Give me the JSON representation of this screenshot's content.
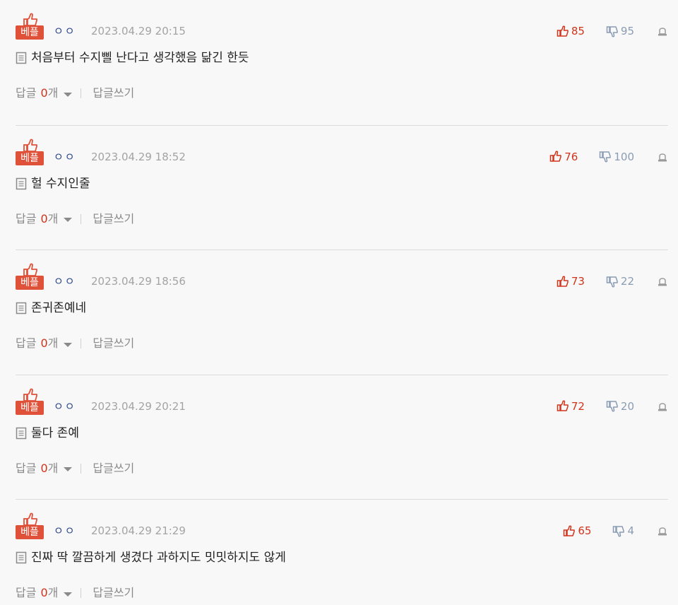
{
  "labels": {
    "best": "베플",
    "reply": "답글",
    "reply_unit": "개",
    "write_reply": "답글쓰기"
  },
  "colors": {
    "accent": "#e0513a",
    "upvote": "#d1341b",
    "downvote": "#8a9cb3",
    "nickname": "#2f4a8c",
    "muted": "#a3a3a3"
  },
  "icons": {
    "best": "thumbs-up-icon",
    "upvote": "thumbs-up-icon",
    "downvote": "thumbs-down-icon",
    "report": "siren-icon",
    "comment": "document-icon"
  },
  "comments": [
    {
      "nickname": "ㅇㅇ",
      "timestamp": "2023.04.29 20:15",
      "up": "85",
      "down": "95",
      "text": "처음부터 수지삘 난다고 생각했음 닮긴 한듯",
      "replies": "0"
    },
    {
      "nickname": "ㅇㅇ",
      "timestamp": "2023.04.29 18:52",
      "up": "76",
      "down": "100",
      "text": "헐 수지인줄",
      "replies": "0"
    },
    {
      "nickname": "ㅇㅇ",
      "timestamp": "2023.04.29 18:56",
      "up": "73",
      "down": "22",
      "text": "존귀존예네",
      "replies": "0"
    },
    {
      "nickname": "ㅇㅇ",
      "timestamp": "2023.04.29 20:21",
      "up": "72",
      "down": "20",
      "text": "둘다 존예",
      "replies": "0"
    },
    {
      "nickname": "ㅇㅇ",
      "timestamp": "2023.04.29 21:29",
      "up": "65",
      "down": "4",
      "text": "진짜 딱 깔끔하게 생겼다 과하지도 밋밋하지도 않게",
      "replies": "0"
    }
  ]
}
